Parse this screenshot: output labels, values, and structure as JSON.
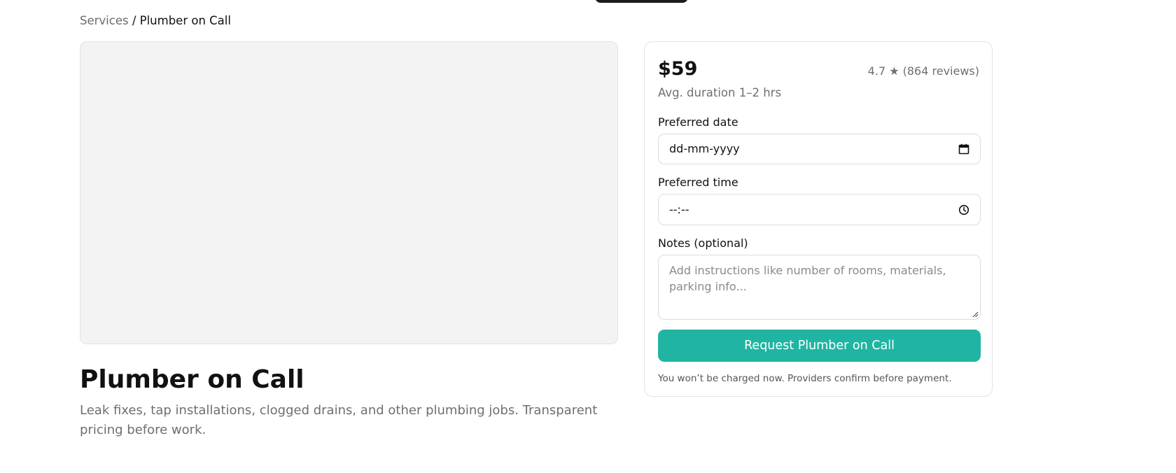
{
  "breadcrumb": {
    "parent": "Services",
    "separator": "/",
    "current": "Plumber on Call"
  },
  "service": {
    "title": "Plumber on Call",
    "description": "Leak fixes, tap installations, clogged drains, and other plumbing jobs. Transparent pricing before work."
  },
  "booking": {
    "price": "$59",
    "rating": "4.7 ★ (864 reviews)",
    "duration": "Avg. duration 1–2 hrs",
    "date": {
      "label": "Preferred date",
      "placeholder": "dd-mm-yyyy"
    },
    "time": {
      "label": "Preferred time",
      "placeholder": "--:--"
    },
    "notes": {
      "label": "Notes (optional)",
      "placeholder": "Add instructions like number of rooms, materials, parking info..."
    },
    "submit_label": "Request Plumber on Call",
    "disclaimer": "You won’t be charged now. Providers confirm before payment."
  },
  "colors": {
    "accent": "#20b5a2",
    "muted_text": "#6f6f6f",
    "media_placeholder": "#f3f3f3"
  },
  "icons": {
    "date": "calendar-icon",
    "time": "clock-icon",
    "notes": "resize-grip-icon"
  }
}
